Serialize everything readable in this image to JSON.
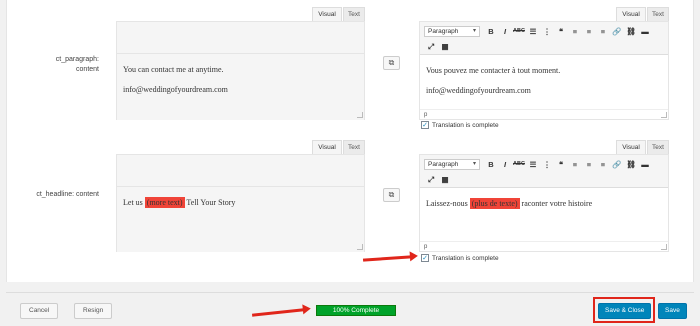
{
  "tabs": {
    "visual": "Visual",
    "text": "Text"
  },
  "toolbar": {
    "format_select": "Paragraph",
    "icons": {
      "bold": "B",
      "italic": "I",
      "strike": "ABC",
      "ul": "☰",
      "ol": "⋮",
      "quote": "❝",
      "align_left": "≡",
      "align_center": "≡",
      "align_right": "≡",
      "link": "🔗",
      "unlink": "⛓",
      "more": "▬",
      "fullscreen": "⤢",
      "kitchen": "▦"
    }
  },
  "fields": [
    {
      "label": "ct_paragraph: content",
      "source_lines": [
        "You can contact me at anytime.",
        "info@weddingofyourdream.com"
      ],
      "target_lines": [
        "Vous pouvez me contacter à tout moment.",
        "info@weddingofyourdream.com"
      ],
      "status_path": "p",
      "translation_complete": "Translation is complete"
    },
    {
      "label": "ct_headline: content",
      "source_before": "Let us ",
      "source_hl": "(more text)",
      "source_after": " Tell Your Story",
      "target_before": "Laissez-nous ",
      "target_hl": "(plus de texte)",
      "target_after": " raconter votre histoire",
      "status_path": "p",
      "translation_complete": "Translation is complete"
    }
  ],
  "footer": {
    "cancel": "Cancel",
    "resign": "Resign",
    "progress": "100% Complete",
    "progress_value": 100,
    "save_close": "Save & Close",
    "save": "Save"
  },
  "colors": {
    "primary": "#0085ba",
    "progress": "#00a32a",
    "highlight": "#f04438",
    "annotation": "#e0261b"
  }
}
